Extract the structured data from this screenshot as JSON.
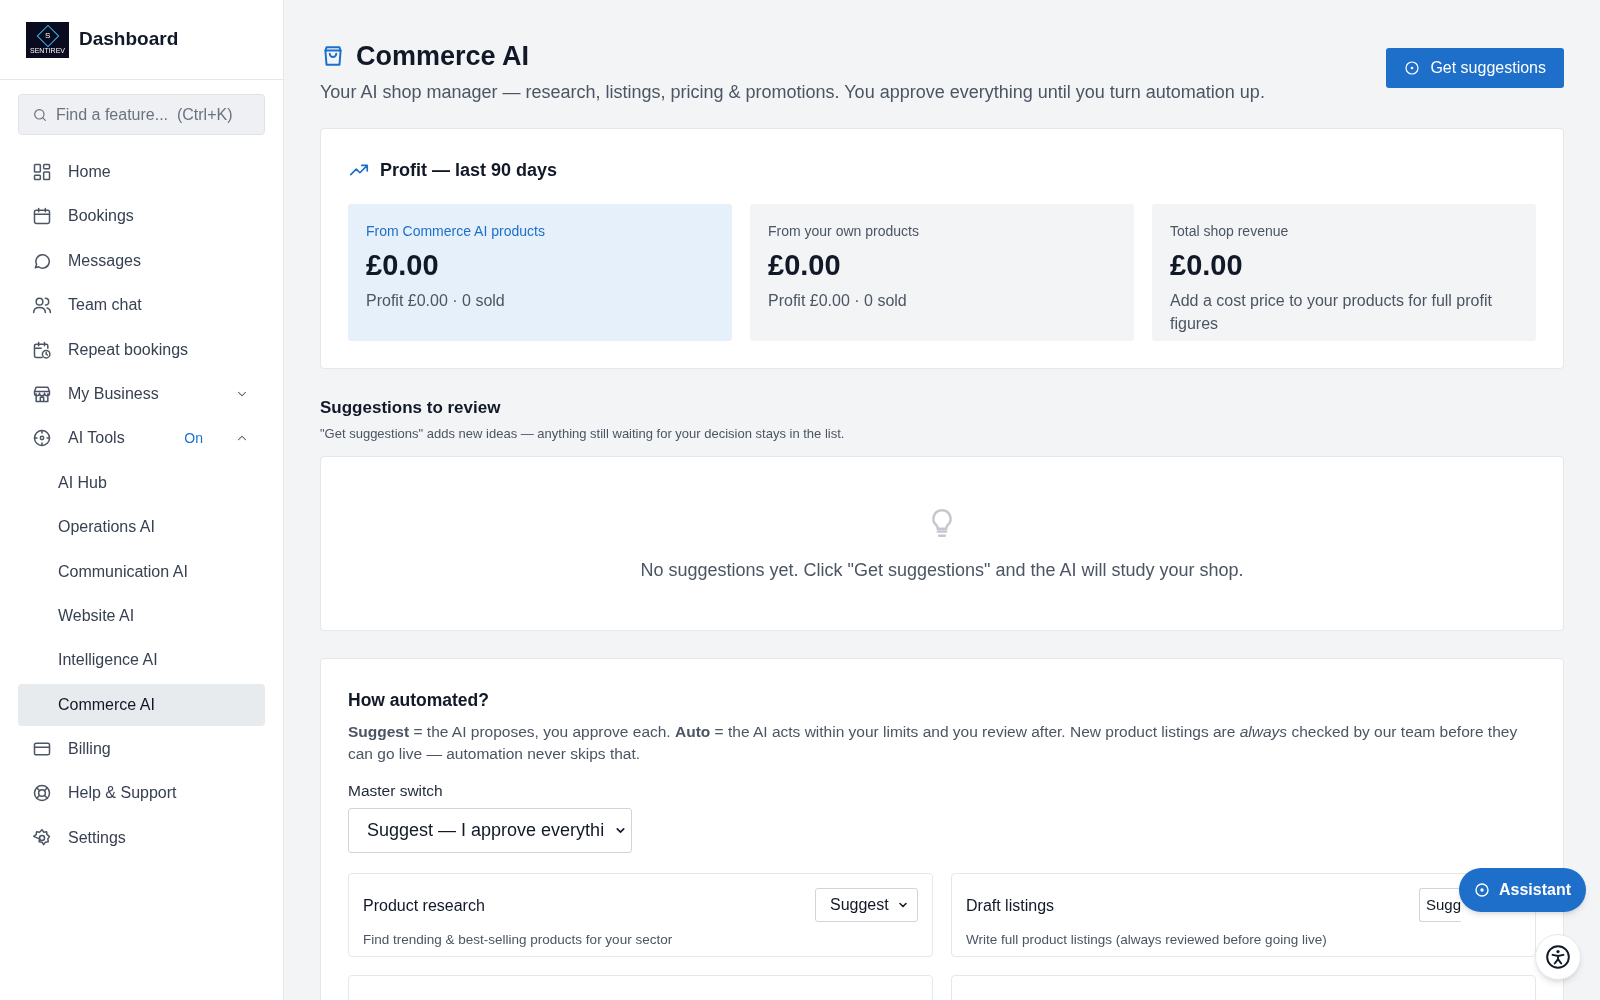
{
  "sidebar": {
    "brand": {
      "logo_letter": "S",
      "logo_caption": "SENTIREV",
      "title": "Dashboard"
    },
    "search": {
      "placeholder": "Find a feature...  (Ctrl+K)"
    },
    "items": [
      {
        "label": "Home",
        "kind": "item",
        "selected": false
      },
      {
        "label": "Bookings",
        "kind": "item",
        "selected": false
      },
      {
        "label": "Messages",
        "kind": "item",
        "selected": false
      },
      {
        "label": "Team chat",
        "kind": "item",
        "selected": false
      },
      {
        "label": "Repeat bookings",
        "kind": "item",
        "selected": false
      },
      {
        "label": "My Business",
        "kind": "group",
        "expanded": false,
        "selected": false
      },
      {
        "label": "AI Tools",
        "kind": "group",
        "expanded": true,
        "badge": "On",
        "selected": false,
        "children": [
          {
            "label": "AI Hub",
            "selected": false
          },
          {
            "label": "Operations AI",
            "selected": false
          },
          {
            "label": "Communication AI",
            "selected": false
          },
          {
            "label": "Website AI",
            "selected": false
          },
          {
            "label": "Intelligence AI",
            "selected": false
          },
          {
            "label": "Commerce AI",
            "selected": true
          }
        ]
      },
      {
        "label": "Billing",
        "kind": "item",
        "selected": false
      },
      {
        "label": "Help & Support",
        "kind": "item",
        "selected": false
      },
      {
        "label": "Settings",
        "kind": "item",
        "selected": false
      }
    ]
  },
  "header": {
    "title": "Commerce AI",
    "subtitle": "Your AI shop manager — research, listings, pricing & promotions. You approve everything until you turn automation up.",
    "button": "Get suggestions"
  },
  "profit": {
    "title": "Profit — last 90 days",
    "cards": [
      {
        "label": "From Commerce AI products",
        "value": "£0.00",
        "note": "Profit £0.00 · 0 sold",
        "selected": true
      },
      {
        "label": "From your own products",
        "value": "£0.00",
        "note": "Profit £0.00 · 0 sold",
        "selected": false
      },
      {
        "label": "Total shop revenue",
        "value": "£0.00",
        "note": "Add a cost price to your products for full profit figures",
        "selected": false
      }
    ]
  },
  "suggestions": {
    "title": "Suggestions to review",
    "hint": "\"Get suggestions\" adds new ideas — anything still waiting for your decision stays in the list.",
    "empty": "No suggestions yet. Click \"Get suggestions\" and the AI will study your shop."
  },
  "automation": {
    "title": "How automated?",
    "text": "**Suggest** = the AI proposes, you approve each. **Auto** = the AI acts within your limits and you review after. New product listings are *always* checked by our team before they can go live — automation never skips that.",
    "master_label": "Master switch",
    "master_value": "Suggest — I approve everythi",
    "tasks": [
      {
        "title": "Product research",
        "desc": "Find trending & best-selling products for your sector",
        "mode": "Suggest"
      },
      {
        "title": "Draft listings",
        "desc": "Write full product listings (always reviewed before going live)",
        "mode": "Sugg"
      }
    ]
  },
  "assistant_button": "Assistant"
}
